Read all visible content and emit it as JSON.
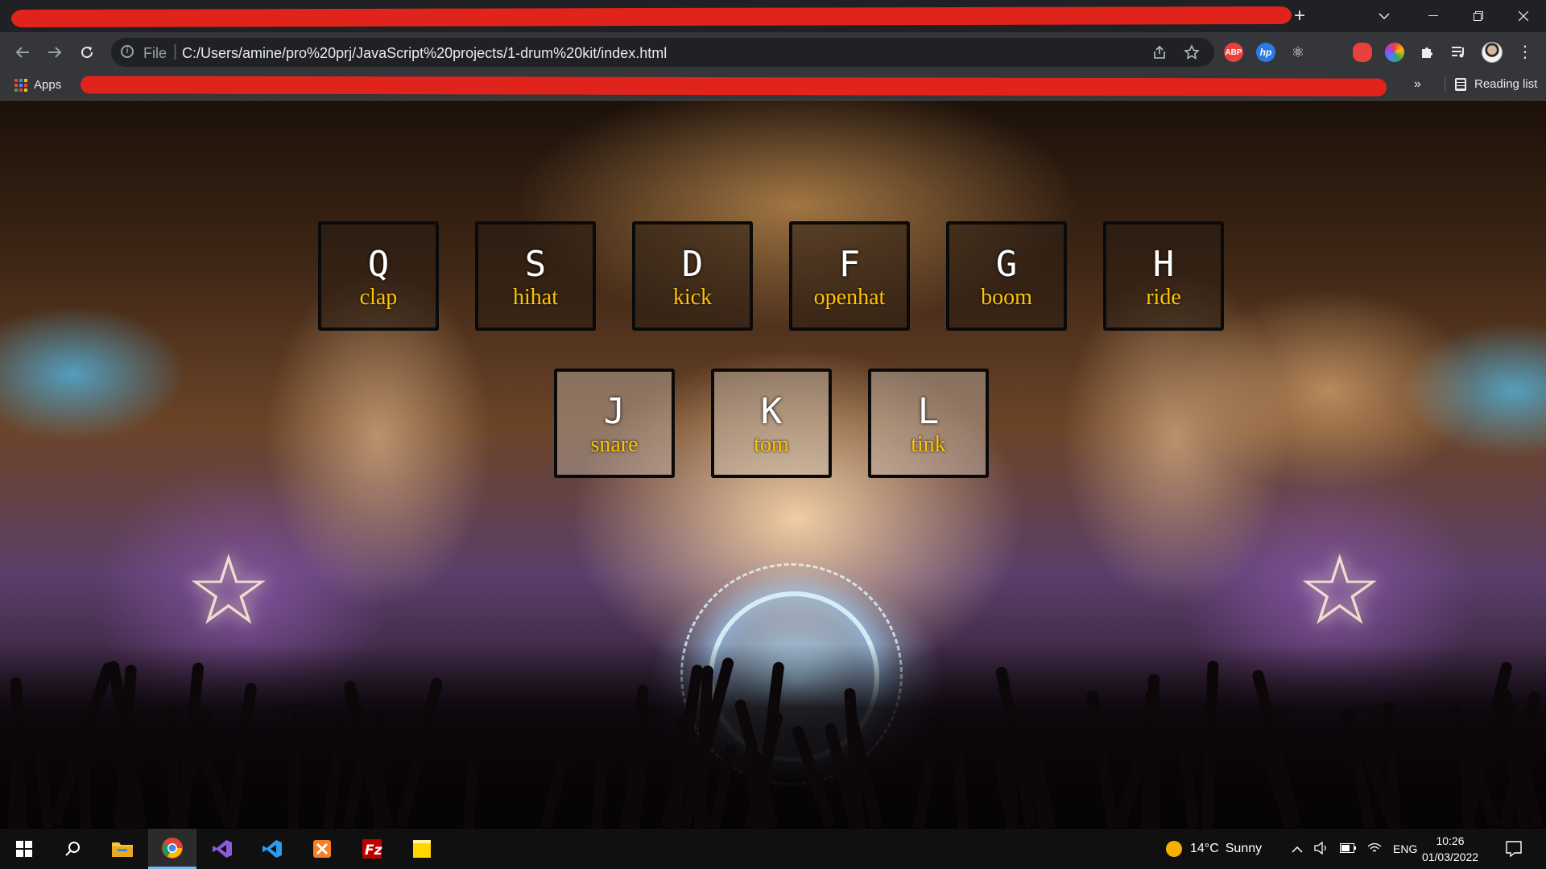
{
  "browser": {
    "new_tab_symbol": "+",
    "omnibox": {
      "scheme_label": "File",
      "url": "C:/Users/amine/pro%20prj/JavaScript%20projects/1-drum%20kit/index.html"
    },
    "bookmarks": {
      "apps_label": "Apps",
      "more_symbol": "»",
      "reading_list_label": "Reading list"
    },
    "extensions": [
      {
        "name": "adblock-plus-icon",
        "text": "ABP",
        "color": "#e8403a"
      },
      {
        "name": "hp-icon",
        "text": "hp",
        "color": "#2a7be4"
      },
      {
        "name": "react-devtools-icon",
        "text": "⚛",
        "color": "#35363a"
      },
      {
        "name": "red-extension-icon",
        "text": "●",
        "color": "#e8403a"
      },
      {
        "name": "color-wheel-icon",
        "text": "",
        "color": "#7a4ad9"
      }
    ]
  },
  "drum_keys": [
    {
      "key": "Q",
      "sound": "clap"
    },
    {
      "key": "S",
      "sound": "hihat"
    },
    {
      "key": "D",
      "sound": "kick"
    },
    {
      "key": "F",
      "sound": "openhat"
    },
    {
      "key": "G",
      "sound": "boom"
    },
    {
      "key": "H",
      "sound": "ride"
    },
    {
      "key": "J",
      "sound": "snare"
    },
    {
      "key": "K",
      "sound": "tom"
    },
    {
      "key": "L",
      "sound": "tink"
    }
  ],
  "taskbar": {
    "weather_temp": "14°C",
    "weather_text": "Sunny",
    "language": "ENG",
    "time": "10:26",
    "date": "01/03/2022",
    "apps": [
      "file-explorer-icon",
      "chrome-icon",
      "visual-studio-icon",
      "vscode-icon",
      "xampp-icon",
      "filezilla-icon",
      "sticky-notes-icon"
    ]
  },
  "colors": {
    "accent_sound": "#ffc600",
    "redaction": "#e0241c",
    "taskbar_active": "#76b9ed"
  }
}
